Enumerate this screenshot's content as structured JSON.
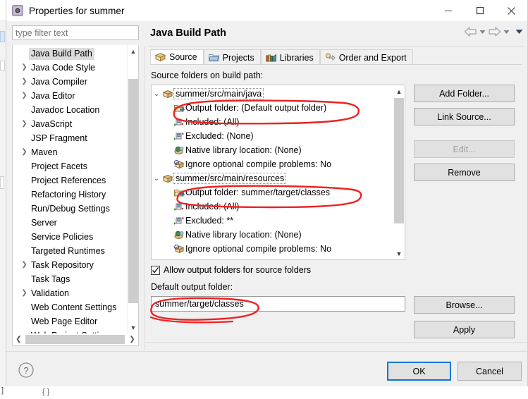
{
  "window": {
    "title": "Properties for summer",
    "icon": "properties-gear-icon",
    "minimize": "minimize",
    "maximize": "maximize",
    "close": "close"
  },
  "sidebar": {
    "filter": {
      "placeholder": "type filter text",
      "value": ""
    },
    "items": [
      {
        "label": "Java Build Path",
        "expandable": false,
        "selected": true
      },
      {
        "label": "Java Code Style",
        "expandable": true,
        "selected": false
      },
      {
        "label": "Java Compiler",
        "expandable": true,
        "selected": false
      },
      {
        "label": "Java Editor",
        "expandable": true,
        "selected": false
      },
      {
        "label": "Javadoc Location",
        "expandable": false,
        "selected": false
      },
      {
        "label": "JavaScript",
        "expandable": true,
        "selected": false
      },
      {
        "label": "JSP Fragment",
        "expandable": false,
        "selected": false
      },
      {
        "label": "Maven",
        "expandable": true,
        "selected": false
      },
      {
        "label": "Project Facets",
        "expandable": false,
        "selected": false
      },
      {
        "label": "Project References",
        "expandable": false,
        "selected": false
      },
      {
        "label": "Refactoring History",
        "expandable": false,
        "selected": false
      },
      {
        "label": "Run/Debug Settings",
        "expandable": false,
        "selected": false
      },
      {
        "label": "Server",
        "expandable": false,
        "selected": false
      },
      {
        "label": "Service Policies",
        "expandable": false,
        "selected": false
      },
      {
        "label": "Targeted Runtimes",
        "expandable": false,
        "selected": false
      },
      {
        "label": "Task Repository",
        "expandable": true,
        "selected": false
      },
      {
        "label": "Task Tags",
        "expandable": false,
        "selected": false
      },
      {
        "label": "Validation",
        "expandable": true,
        "selected": false
      },
      {
        "label": "Web Content Settings",
        "expandable": false,
        "selected": false
      },
      {
        "label": "Web Page Editor",
        "expandable": false,
        "selected": false
      },
      {
        "label": "Web Project Settings",
        "expandable": false,
        "selected": false
      }
    ]
  },
  "main": {
    "title": "Java Build Path",
    "nav": {
      "back": "back-arrow",
      "back_menu": "back-dropdown",
      "forward": "forward-arrow",
      "forward_menu": "forward-dropdown",
      "view_menu": "view-menu"
    },
    "tabs": [
      {
        "label": "Source",
        "icon": "source-package-icon",
        "active": true
      },
      {
        "label": "Projects",
        "icon": "folder-icon",
        "active": false
      },
      {
        "label": "Libraries",
        "icon": "books-icon",
        "active": false
      },
      {
        "label": "Order and Export",
        "icon": "order-export-icon",
        "active": false
      }
    ],
    "section_label": "Source folders on build path:",
    "tree": [
      {
        "level": 0,
        "icon": "source-folder-icon",
        "text": "summer/src/main/java",
        "expanded": true
      },
      {
        "level": 1,
        "icon": "output-folder-icon",
        "text": "Output folder: (Default output folder)"
      },
      {
        "level": 1,
        "icon": "included-icon",
        "text": "Included: (All)"
      },
      {
        "level": 1,
        "icon": "excluded-icon",
        "text": "Excluded: (None)"
      },
      {
        "level": 1,
        "icon": "native-library-icon",
        "text": "Native library location: (None)"
      },
      {
        "level": 1,
        "icon": "compile-problems-icon",
        "text": "Ignore optional compile problems: No"
      },
      {
        "level": 0,
        "icon": "source-folder-icon",
        "text": "summer/src/main/resources",
        "expanded": true
      },
      {
        "level": 1,
        "icon": "output-folder-icon",
        "text": "Output folder: summer/target/classes"
      },
      {
        "level": 1,
        "icon": "included-icon",
        "text": "Included: (All)"
      },
      {
        "level": 1,
        "icon": "excluded-icon",
        "text": "Excluded: **"
      },
      {
        "level": 1,
        "icon": "native-library-icon",
        "text": "Native library location: (None)"
      },
      {
        "level": 1,
        "icon": "compile-problems-icon",
        "text": "Ignore optional compile problems: No"
      }
    ],
    "side_buttons": [
      {
        "label": "Add Folder...",
        "mnemonic": "d",
        "enabled": true
      },
      {
        "label": "Link Source...",
        "mnemonic": "i",
        "enabled": true
      },
      {
        "label": "Edit...",
        "mnemonic": "E",
        "enabled": false
      },
      {
        "label": "Remove",
        "mnemonic": "R",
        "enabled": true
      }
    ],
    "allow_output_checkbox": {
      "label": "Allow output folders for source folders",
      "checked": true
    },
    "default_output_label": "Default output folder:",
    "default_output_value": "summer/target/classes",
    "browse_button": "Browse...",
    "apply_button": "Apply"
  },
  "footer": {
    "help": "help-icon",
    "ok": "OK",
    "cancel": "Cancel"
  },
  "annotations": {
    "color": "#ee2222",
    "marks": [
      "circle-output-folder-default",
      "circle-output-folder-target-classes",
      "circle-default-output-field"
    ]
  }
}
